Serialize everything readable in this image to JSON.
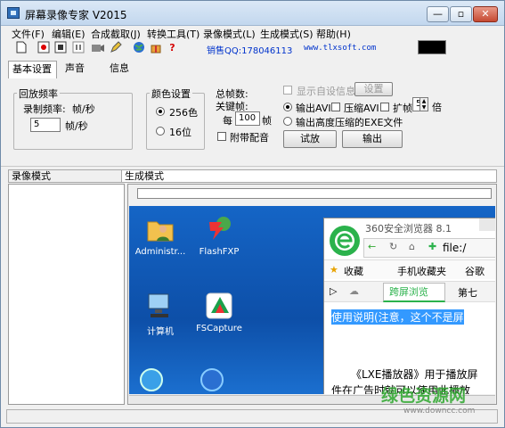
{
  "window": {
    "title": "屏幕录像专家 V2015"
  },
  "window_buttons": {
    "minimize": "—",
    "restore": "▫",
    "close": "✕"
  },
  "menu": [
    "文件(F)",
    "编辑(E)",
    "合成截取(J)",
    "转换工具(T)",
    "录像模式(L)",
    "生成模式(S)",
    "帮助(H)"
  ],
  "toolbar": {
    "icons": [
      "new-file-icon",
      "record-icon",
      "stop-icon",
      "pause-icon",
      "camera-icon",
      "pen-icon",
      "globe-icon",
      "gift-icon",
      "help-icon"
    ],
    "sales": "销售QQ:178046113",
    "website": "www.tlxsoft.com"
  },
  "tabs": [
    "基本设置",
    "声音",
    "信息"
  ],
  "playback": {
    "group_label": "回放频率",
    "record_rate_label": "录制频率:",
    "record_rate_unit": "帧/秒",
    "rate_value": "5",
    "rate_unit": "帧/秒"
  },
  "color": {
    "group_label": "颜色设置",
    "option_256": "256色",
    "option_16": "16位"
  },
  "frames": {
    "total_label": "总帧数:",
    "keyframe_label": "关键帧:",
    "every_label": "每",
    "every_value": "100",
    "frame_unit": "帧",
    "attach_audio": "附带配音"
  },
  "output": {
    "show_info": "显示自设信息",
    "settings_button": "设置",
    "output_avi": "输出AVI",
    "compress_avi": "压缩AVI",
    "expand_frame": "扩帧",
    "expand_value": "5",
    "times": "倍",
    "output_exe": "输出高度压缩的EXE文件",
    "play_button": "试放",
    "export_button": "输出"
  },
  "panels": {
    "record_mode": "录像模式",
    "generate_mode": "生成模式"
  },
  "desktop": {
    "icons": [
      {
        "label": "Administr...",
        "icon": "user-folder-icon"
      },
      {
        "label": "FlashFXP",
        "icon": "flashfxp-icon"
      },
      {
        "label": "计算机",
        "icon": "computer-icon"
      },
      {
        "label": "FSCapture",
        "icon": "fscapture-icon"
      }
    ]
  },
  "browser": {
    "title": "360安全浏览器 8.1",
    "address": "file:/",
    "bookmarks": [
      "收藏",
      "手机收藏夹",
      "谷歌"
    ],
    "tabs": [
      "跨屏浏览",
      "第七"
    ],
    "selected_text": "使用说明(注意，这个不是屏",
    "body_text": "《LXE播放器》用于播放屏",
    "body_text2": "件在广告时就可以使用此播放"
  },
  "colors": {
    "accent": "#0033cc",
    "desktop_blue": "#1565c6",
    "watermark_green": "#2fa82f"
  },
  "watermark": {
    "text": "绿色资源网",
    "url": "www.downcc.com"
  }
}
